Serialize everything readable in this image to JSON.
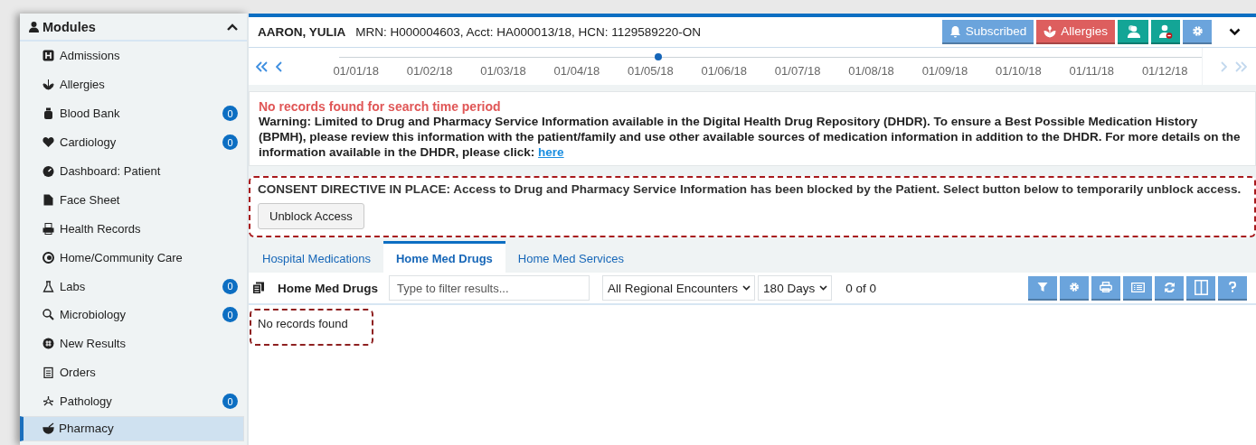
{
  "sidebar": {
    "title": "Modules",
    "expanded": true,
    "items": [
      {
        "label": "Admissions",
        "selected": false
      },
      {
        "label": "Allergies",
        "selected": false
      },
      {
        "label": "Blood Bank",
        "badge": "0",
        "selected": false
      },
      {
        "label": "Cardiology",
        "badge": "0",
        "selected": false
      },
      {
        "label": "Dashboard: Patient",
        "selected": false
      },
      {
        "label": "Face Sheet",
        "selected": false
      },
      {
        "label": "Health Records",
        "selected": false
      },
      {
        "label": "Home/Community Care",
        "selected": false
      },
      {
        "label": "Labs",
        "badge": "0",
        "selected": false
      },
      {
        "label": "Microbiology",
        "badge": "0",
        "selected": false
      },
      {
        "label": "New Results",
        "selected": false
      },
      {
        "label": "Orders",
        "selected": false
      },
      {
        "label": "Pathology",
        "badge": "0",
        "selected": false
      },
      {
        "label": "Pharmacy",
        "selected": true
      }
    ]
  },
  "patient": {
    "name": "AARON, YULIA",
    "ids": "MRN: H000004603, Acct: HA000013/18, HCN: 1129589220-ON"
  },
  "header_buttons": [
    {
      "kind": "subscribe",
      "label": "Subscribed"
    },
    {
      "kind": "allergies",
      "label": "Allergies"
    },
    {
      "kind": "group"
    },
    {
      "kind": "remove"
    },
    {
      "kind": "settings"
    }
  ],
  "timeline": {
    "dates": [
      "01/01/18",
      "01/02/18",
      "01/03/18",
      "01/04/18",
      "01/05/18",
      "01/06/18",
      "01/07/18",
      "01/08/18",
      "01/09/18",
      "01/10/18",
      "01/11/18",
      "01/12/18"
    ],
    "level": 0.37
  },
  "notice": {
    "title": "No records found for search time period",
    "text": "Warning: Limited to Drug and Pharmacy Service Information available in the Digital Health Drug Repository (DHDR). To ensure a Best Possible Medication History (BPMH), please review this information with the patient/family and use other available sources of medication information in addition to the DHDR. For more details on the information available in the DHDR, please click:",
    "link": "here"
  },
  "consent": {
    "text": "CONSENT DIRECTIVE IN PLACE: Access to Drug and Pharmacy Service Information has been blocked by the Patient. Select button below to temporarily unblock access.",
    "button": "Unblock Access"
  },
  "tabs": [
    {
      "label": "Hospital Medications",
      "selected": false
    },
    {
      "label": "Home Med Drugs",
      "selected": true
    },
    {
      "label": "Home Med Services",
      "selected": false
    }
  ],
  "toolbar": {
    "title": "Home Med Drugs",
    "filter_placeholder": "Type to filter results...",
    "encounters": "All Regional Encounters",
    "period": "180 Days",
    "count": "0 of 0",
    "buttons": [
      {
        "kind": "filter"
      },
      {
        "kind": "settings"
      },
      {
        "kind": "print"
      },
      {
        "kind": "list"
      },
      {
        "kind": "refresh"
      },
      {
        "kind": "columns"
      },
      {
        "kind": "help"
      }
    ]
  },
  "empty_message": "No records found"
}
